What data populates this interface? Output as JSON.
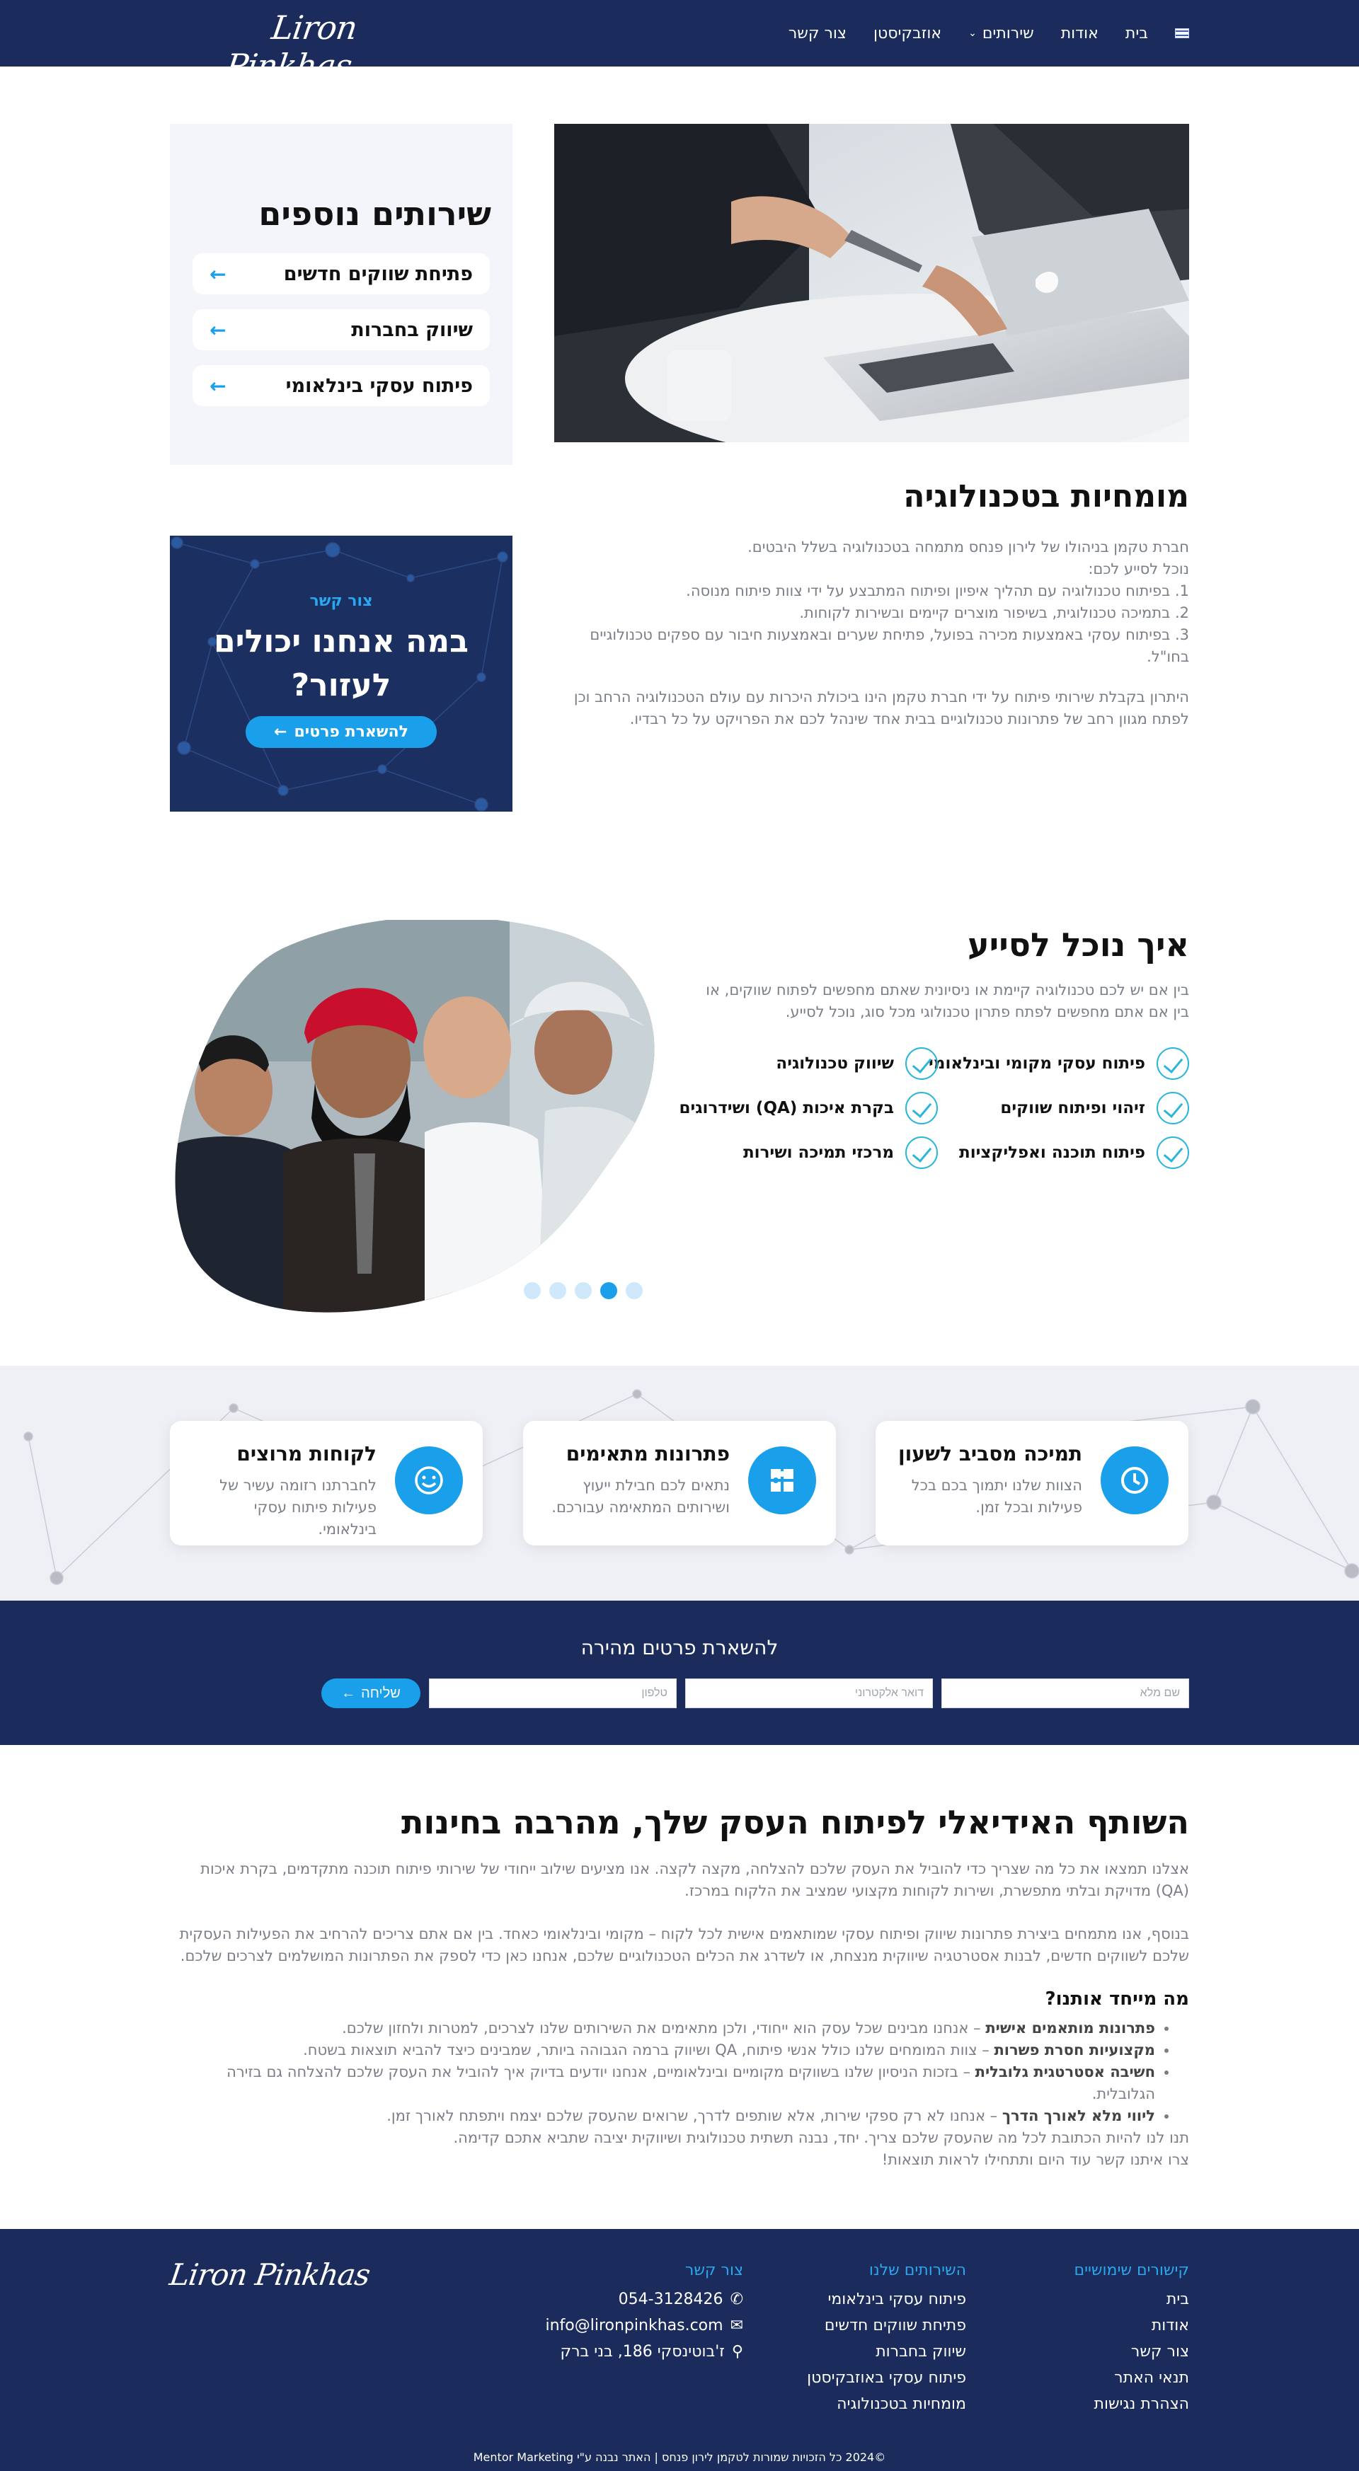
{
  "header": {
    "logo": "Liron Pinkhas",
    "nav": [
      "בית",
      "אודות",
      "שירותים",
      "אוזבקיסטן",
      "צור קשר"
    ]
  },
  "side_services": {
    "title": "שירותים נוספים",
    "items": [
      "פתיחת שווקים חדשים",
      "שיווק בחברות",
      "פיתוח עסקי בינלאומי"
    ]
  },
  "article": {
    "title": "מומחיות בטכנולוגיה",
    "lines": [
      "חברת טקמן בניהולו של לירון פנחס מתמחה בטכנולוגיה בשלל היבטים.",
      "נוכל לסייע לכם:",
      "1. בפיתוח טכנולוגיה עם תהליך איפיון ופיתוח המתבצע על ידי צוות פיתוח מנוסה.",
      "2. בתמיכה טכנולוגית, בשיפור מוצרים קיימים ובשירות לקוחות.",
      "3. בפיתוח עסקי באמצעות מכירה בפועל, פתיחת שערים ובאמצעות חיבור עם ספקים טכנולוגיים בחו\"ל."
    ],
    "closing": "היתרון בקבלת שירותי פיתוח על ידי חברת טקמן הינו ביכולת היכרות עם עולם הטכנולוגיה הרחב וכן לפתח מגוון רחב של פתרונות טכנולוגיים בבית אחד שינהל לכם את הפרויקט על כל רבדיו."
  },
  "help_card": {
    "small": "צור קשר",
    "big": "במה אנחנו יכולים לעזור?",
    "button": "להשארת פרטים"
  },
  "assist": {
    "title": "איך נוכל לסייע",
    "body": "בין אם יש לכם טכנולוגיה קיימת או ניסיונית שאתם מחפשים לפתוח שווקים, או בין אם אתם מחפשים לפתח פתרון טכנולוגי מכל סוג, נוכל לסייע.",
    "features": [
      "פיתוח עסקי מקומי ובינלאומי",
      "שיווק טכנולוגיה",
      "זיהוי ופיתוח שווקים",
      "בקרת איכות (QA) ושידרוגים",
      "פיתוח תוכנה ואפליקציות",
      "מרכזי תמיכה ושירות"
    ],
    "carousel_dots": 5,
    "carousel_active": 2
  },
  "highlights": [
    {
      "title": "תמיכה מסביב לשעון",
      "desc": "הצוות שלנו יתמוך בכם בכל פעילות ובכל זמן.",
      "icon": "clock-icon"
    },
    {
      "title": "פתרונות מתאימים",
      "desc": "נתאים לכם חבילת ייעוץ ושירותים המתאימה עבורכם.",
      "icon": "puzzle-icon"
    },
    {
      "title": "לקוחות מרוצים",
      "desc": "לחברתנו רזומה עשיר של פעילות פיתוח עסקי בינלאומי.",
      "icon": "smile-icon"
    }
  ],
  "quick_form": {
    "title": "להשארת פרטים מהירה",
    "name_placeholder": "שם מלא",
    "email_placeholder": "דואר אלקטרוני",
    "phone_placeholder": "טלפון",
    "submit": "שליחה"
  },
  "about": {
    "title": "השותף האידיאלי לפיתוח העסק שלך, מהרבה בחינות",
    "p1": "אצלנו תמצאו את כל מה שצריך כדי להוביל את העסק שלכם להצלחה, מקצה לקצה. אנו מציעים שילוב ייחודי של שירותי פיתוח תוכנה מתקדמים, בקרת איכות (QA) מדויקת ובלתי מתפשרת, ושירות לקוחות מקצועי שמציב את הלקוח במרכז.",
    "p2": "בנוסף, אנו מתמחים ביצירת פתרונות שיווק ופיתוח עסקי שמותאמים אישית לכל לקוח – מקומי ובינלאומי כאחד. בין אם אתם צריכים להרחיב את הפעילות העסקית שלכם לשווקים חדשים, לבנות אסטרטגיה שיווקית מנצחת, או לשדרג את הכלים הטכנולוגיים שלכם, אנחנו כאן כדי לספק את הפתרונות המושלמים לצרכים שלכם.",
    "subtitle": "מה מייחד אותנו?",
    "bullets": [
      {
        "b": "פתרונות מותאמים אישית",
        "t": " – אנחנו מבינים שכל עסק הוא ייחודי, ולכן מתאימים את השירותים שלנו לצרכים, למטרות ולחזון שלכם."
      },
      {
        "b": "מקצועיות חסרת פשרות",
        "t": " – צוות המומחים שלנו כולל אנשי פיתוח, QA ושיווק ברמה הגבוהה ביותר, שמבינים כיצד להביא תוצאות בשטח."
      },
      {
        "b": "חשיבה אסטרטגית גלובלית",
        "t": " – בזכות הניסיון שלנו בשווקים מקומיים ובינלאומיים, אנחנו יודעים בדיוק איך להוביל את העסק שלכם להצלחה גם בזירה הגלובלית."
      },
      {
        "b": "ליווי מלא לאורך הדרך",
        "t": " – אנחנו לא רק ספקי שירות, אלא שותפים לדרך, שרואים שהעסק שלכם יצמח ויתפתח לאורך זמן."
      }
    ],
    "closing1": "תנו לנו להיות הכתובת לכל מה שהעסק שלכם צריך. יחד, נבנה תשתית טכנולוגית ושיווקית יציבה שתביא אתכם קדימה.",
    "closing2": "צרו איתנו קשר עוד היום ותתחילו לראות תוצאות!"
  },
  "footer": {
    "col_links_title": "קישורים שימושיים",
    "links": [
      "בית",
      "אודות",
      "צור קשר",
      "תנאי האתר",
      "הצהרת נגישות"
    ],
    "col_services_title": "השירותים שלנו",
    "services": [
      "פיתוח עסקי בינלאומי",
      "פתיחת שווקים חדשים",
      "שיווק בחברות",
      "פיתוח עסקי באוזבקיסטן",
      "מומחיות בטכנולוגיה"
    ],
    "col_contact_title": "צור קשר",
    "phone": "054-3128426",
    "email": "info@lironpinkhas.com",
    "address": "ז'בוטינסקי 186, בני ברק",
    "copyright": "©2024 כל הזכויות שמורות לטקמן לירון פנחס | האתר נבנה ע\"י Mentor Marketing"
  },
  "colors": {
    "navy": "#1b2b5b",
    "accent": "#1aa0ea",
    "check": "#29b6d8"
  }
}
